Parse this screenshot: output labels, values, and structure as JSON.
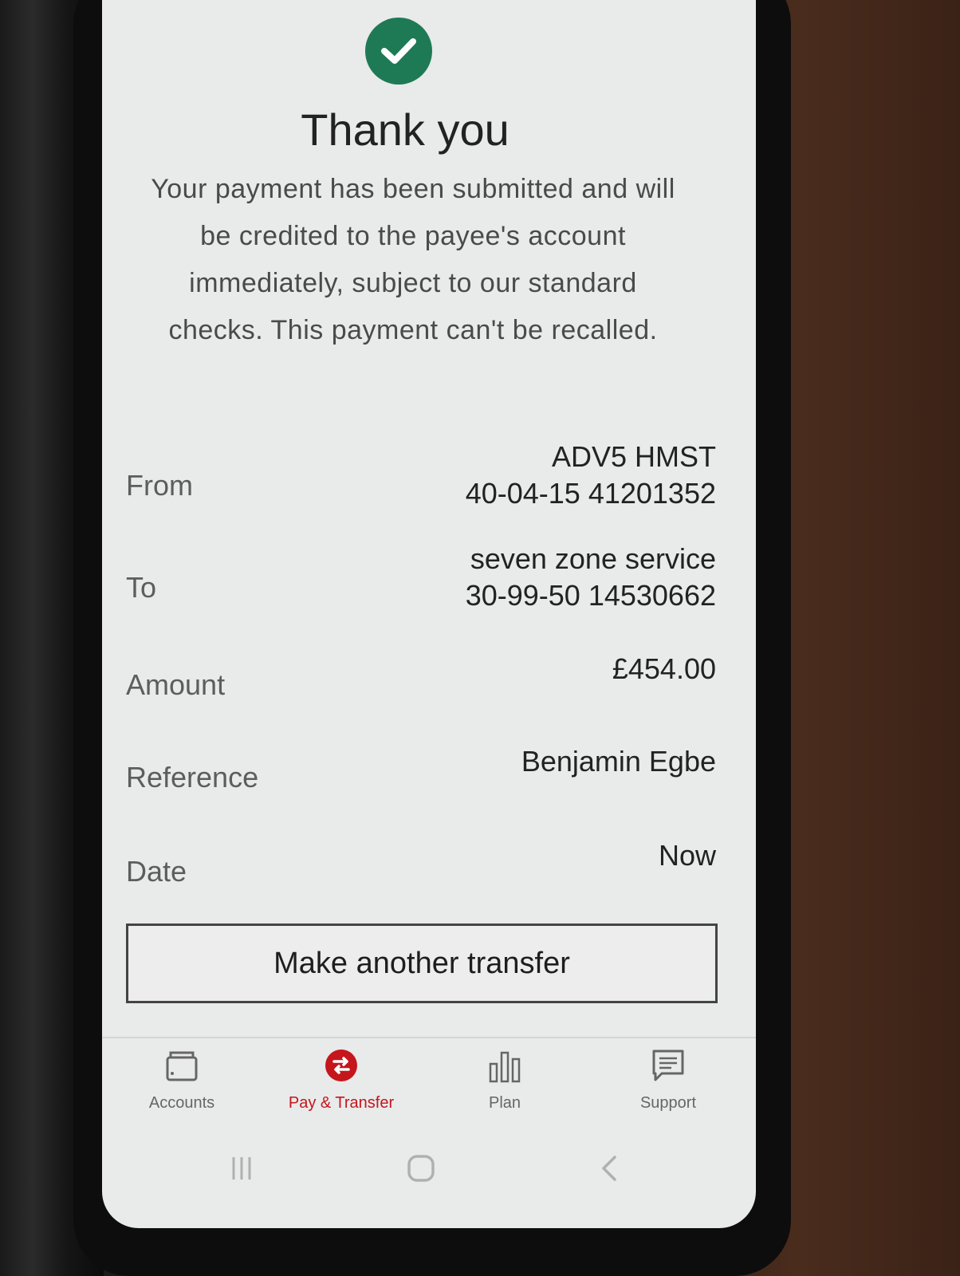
{
  "confirmation": {
    "title": "Thank you",
    "message": "Your payment has been submitted and will be credited to the payee's account immediately, subject to our standard checks. This payment can't be recalled."
  },
  "details": {
    "from_label": "From",
    "from_name": "ADV5 HMST",
    "from_account": "40-04-15 41201352",
    "to_label": "To",
    "to_name": "seven zone service",
    "to_account": "30-99-50 14530662",
    "amount_label": "Amount",
    "amount_value": "£454.00",
    "reference_label": "Reference",
    "reference_value": "Benjamin Egbe",
    "date_label": "Date",
    "date_value": "Now"
  },
  "actions": {
    "make_another": "Make another transfer"
  },
  "tabbar": {
    "items": [
      {
        "label": "Accounts",
        "icon": "wallet-icon"
      },
      {
        "label": "Pay & Transfer",
        "icon": "transfer-icon"
      },
      {
        "label": "Plan",
        "icon": "bar-chart-icon"
      },
      {
        "label": "Support",
        "icon": "chat-icon"
      }
    ],
    "active_color": "#c4161c"
  },
  "colors": {
    "success": "#1e7a55",
    "brand_red": "#c4161c"
  }
}
